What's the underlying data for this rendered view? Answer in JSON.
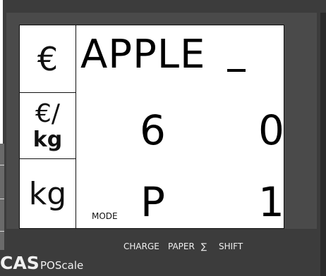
{
  "display": {
    "unit_price_symbol": "€",
    "unit_per_kg_top": "€/",
    "unit_per_kg_bottom": "kg",
    "unit_weight": "kg",
    "item_name": "APPLE",
    "price_digit_left": "6",
    "price_digit_right": "0",
    "weight_digit_left": "P",
    "weight_digit_right": "1",
    "mode_label": "MODE"
  },
  "keys": {
    "charge": "CHARGE",
    "paper": "PAPER",
    "sigma": "∑",
    "shift": "SHIFT"
  },
  "brand": {
    "name": "CAS",
    "model": "POScale"
  },
  "colors": {
    "body": "#3c3c3c",
    "lcd": "#ffffff",
    "text_light": "#f0f0f0"
  }
}
